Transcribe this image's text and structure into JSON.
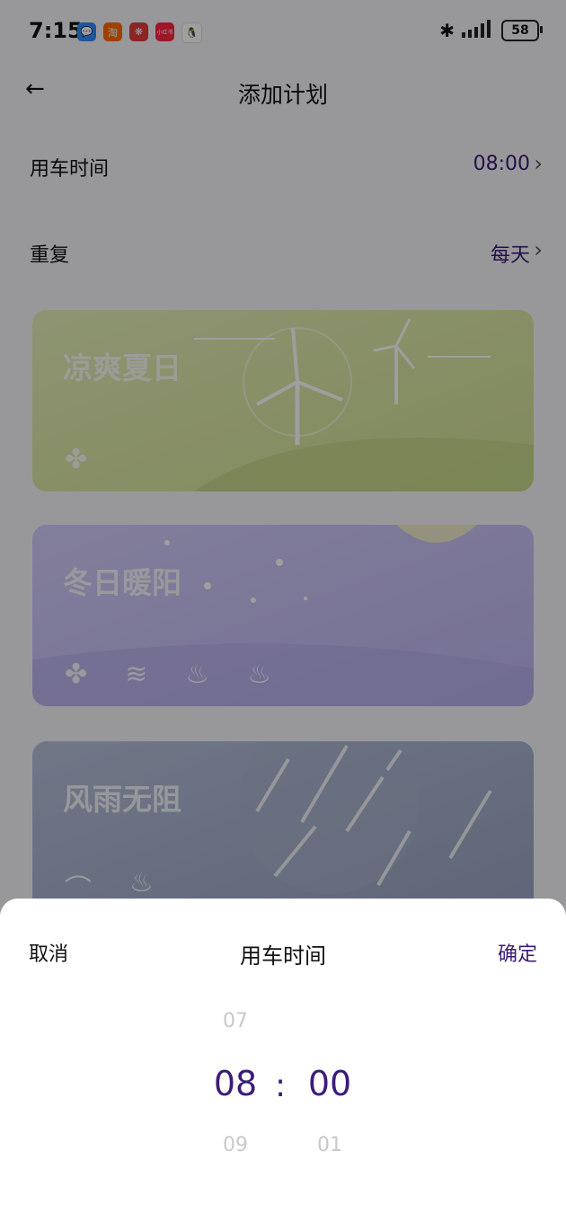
{
  "statusbar": {
    "time": "7:15",
    "apps": [
      {
        "name": "messages-app-icon",
        "glyph": "💬",
        "color": "#2f8cff"
      },
      {
        "name": "taobao-app-icon",
        "glyph": "淘",
        "color": "#ff6a00"
      },
      {
        "name": "flower-app-icon",
        "glyph": "❋",
        "color": "#e33b3b"
      },
      {
        "name": "xiaohongshu-app-icon",
        "glyph": "小红书",
        "color": "#ff2442"
      },
      {
        "name": "qq-app-icon",
        "glyph": "🐧",
        "color": "#111111"
      }
    ],
    "battery": "58"
  },
  "header": {
    "title": "添加计划",
    "back_icon": "←"
  },
  "settings": {
    "car_time": {
      "label": "用车时间",
      "value": "08:00"
    },
    "repeat": {
      "label": "重复",
      "value": "每天"
    }
  },
  "cards": [
    {
      "title": "凉爽夏日",
      "bg": "#d9e6a4",
      "icons": [
        "✤"
      ]
    },
    {
      "title": "冬日暖阳",
      "bg": "#c8c3f5",
      "icons": [
        "✤",
        "≋",
        "♨",
        "♨"
      ]
    },
    {
      "title": "风雨无阻",
      "bg": "#a9b4cf",
      "icons": [
        "⌒",
        "♨"
      ]
    }
  ],
  "sheet": {
    "cancel": "取消",
    "title": "用车时间",
    "confirm": "确定",
    "hour": {
      "prev": "07",
      "current": "08",
      "next": "09"
    },
    "minute": {
      "current": "00",
      "next": "01"
    },
    "separator": ":"
  }
}
